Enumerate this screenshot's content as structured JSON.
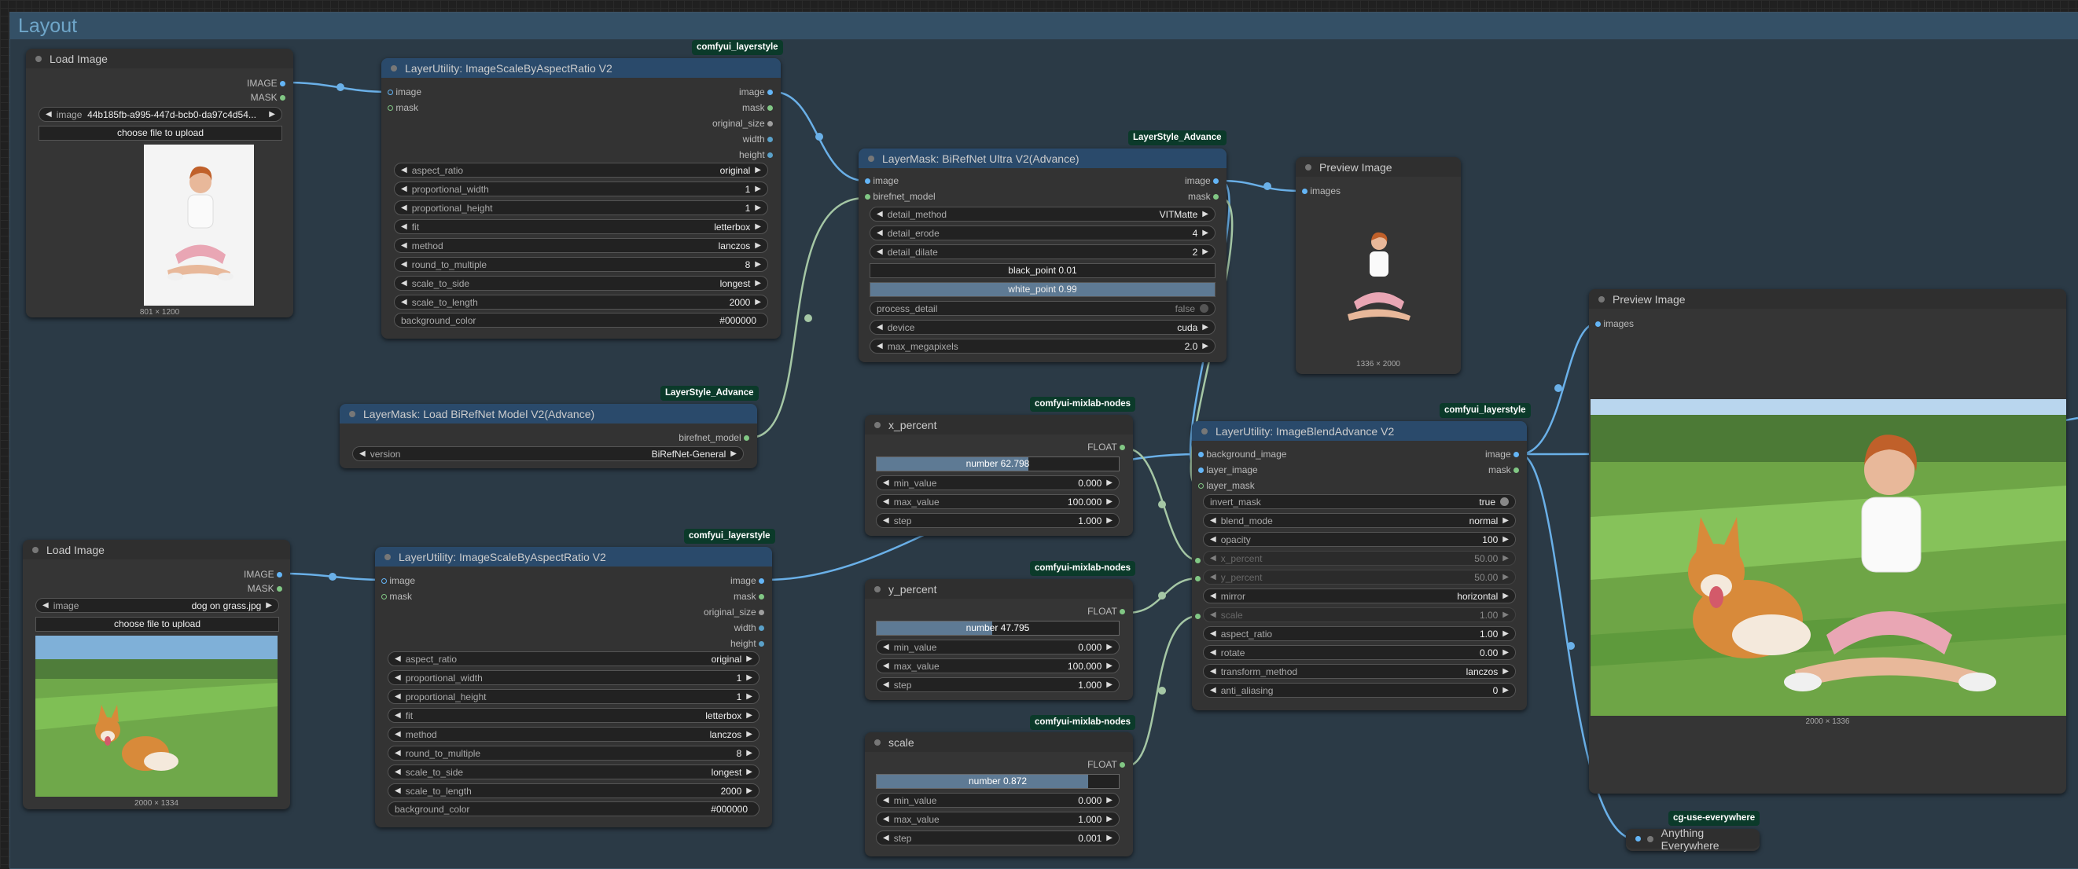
{
  "group": {
    "title": "Layout"
  },
  "load1": {
    "title": "Load Image",
    "out_image": "IMAGE",
    "out_mask": "MASK",
    "image_label": "image",
    "image_value": "44b185fb-a995-447d-bcb0-da97c4d54...",
    "upload": "choose file to upload",
    "dims": "801 × 1200"
  },
  "load2": {
    "title": "Load Image",
    "out_image": "IMAGE",
    "out_mask": "MASK",
    "image_label": "image",
    "image_value": "dog on grass.jpg",
    "upload": "choose file to upload",
    "dims": "2000 × 1334"
  },
  "scale1": {
    "badge": "comfyui_layerstyle",
    "title": "LayerUtility: ImageScaleByAspectRatio V2",
    "inputs": [
      "image",
      "mask"
    ],
    "outputs": [
      "image",
      "mask",
      "original_size",
      "width",
      "height"
    ],
    "widgets": [
      {
        "l": "aspect_ratio",
        "v": "original"
      },
      {
        "l": "proportional_width",
        "v": "1"
      },
      {
        "l": "proportional_height",
        "v": "1"
      },
      {
        "l": "fit",
        "v": "letterbox"
      },
      {
        "l": "method",
        "v": "lanczos"
      },
      {
        "l": "round_to_multiple",
        "v": "8"
      },
      {
        "l": "scale_to_side",
        "v": "longest"
      },
      {
        "l": "scale_to_length",
        "v": "2000"
      }
    ],
    "bg_label": "background_color",
    "bg_value": "#000000"
  },
  "scale2": {
    "badge": "comfyui_layerstyle",
    "title": "LayerUtility: ImageScaleByAspectRatio V2",
    "inputs": [
      "image",
      "mask"
    ],
    "outputs": [
      "image",
      "mask",
      "original_size",
      "width",
      "height"
    ],
    "widgets": [
      {
        "l": "aspect_ratio",
        "v": "original"
      },
      {
        "l": "proportional_width",
        "v": "1"
      },
      {
        "l": "proportional_height",
        "v": "1"
      },
      {
        "l": "fit",
        "v": "letterbox"
      },
      {
        "l": "method",
        "v": "lanczos"
      },
      {
        "l": "round_to_multiple",
        "v": "8"
      },
      {
        "l": "scale_to_side",
        "v": "longest"
      },
      {
        "l": "scale_to_length",
        "v": "2000"
      }
    ],
    "bg_label": "background_color",
    "bg_value": "#000000"
  },
  "loadmodel": {
    "badge": "LayerStyle_Advance",
    "title": "LayerMask: Load BiRefNet Model V2(Advance)",
    "output": "birefnet_model",
    "version_label": "version",
    "version_value": "BiRefNet-General"
  },
  "birefnet": {
    "badge": "LayerStyle_Advance",
    "title": "LayerMask: BiRefNet Ultra V2(Advance)",
    "inputs": [
      "image",
      "birefnet_model"
    ],
    "outputs": [
      "image",
      "mask"
    ],
    "w1": [
      {
        "l": "detail_method",
        "v": "VITMatte"
      },
      {
        "l": "detail_erode",
        "v": "4"
      },
      {
        "l": "detail_dilate",
        "v": "2"
      }
    ],
    "black_point": "black_point  0.01",
    "white_point": "white_point  0.99",
    "process_label": "process_detail",
    "process_value": "false",
    "w2": [
      {
        "l": "device",
        "v": "cuda"
      },
      {
        "l": "max_megapixels",
        "v": "2.0"
      }
    ]
  },
  "preview1": {
    "title": "Preview Image",
    "input": "images",
    "dims": "1336 × 2000"
  },
  "preview2": {
    "title": "Preview Image",
    "input": "images",
    "dims": "2000 × 1336"
  },
  "xpercent": {
    "badge": "comfyui-mixlab-nodes",
    "title": "x_percent",
    "out": "FLOAT",
    "number": "number  62.798",
    "fill": 0.628,
    "widgets": [
      {
        "l": "min_value",
        "v": "0.000"
      },
      {
        "l": "max_value",
        "v": "100.000"
      },
      {
        "l": "step",
        "v": "1.000"
      }
    ]
  },
  "ypercent": {
    "badge": "comfyui-mixlab-nodes",
    "title": "y_percent",
    "out": "FLOAT",
    "number": "number  47.795",
    "fill": 0.478,
    "widgets": [
      {
        "l": "min_value",
        "v": "0.000"
      },
      {
        "l": "max_value",
        "v": "100.000"
      },
      {
        "l": "step",
        "v": "1.000"
      }
    ]
  },
  "scalenode": {
    "badge": "comfyui-mixlab-nodes",
    "title": "scale",
    "out": "FLOAT",
    "number": "number  0.872",
    "fill": 0.872,
    "widgets": [
      {
        "l": "min_value",
        "v": "0.000"
      },
      {
        "l": "max_value",
        "v": "1.000"
      },
      {
        "l": "step",
        "v": "0.001"
      }
    ]
  },
  "blend": {
    "badge": "comfyui_layerstyle",
    "title": "LayerUtility: ImageBlendAdvance V2",
    "inputs": [
      "background_image",
      "layer_image",
      "layer_mask"
    ],
    "outputs": [
      "image",
      "mask"
    ],
    "invert_label": "invert_mask",
    "invert_value": "true",
    "widgets": [
      {
        "l": "blend_mode",
        "v": "normal",
        "d": false
      },
      {
        "l": "opacity",
        "v": "100",
        "d": false
      },
      {
        "l": "x_percent",
        "v": "50.00",
        "d": true
      },
      {
        "l": "y_percent",
        "v": "50.00",
        "d": true
      },
      {
        "l": "mirror",
        "v": "horizontal",
        "d": false
      },
      {
        "l": "scale",
        "v": "1.00",
        "d": true
      },
      {
        "l": "aspect_ratio",
        "v": "1.00",
        "d": false
      },
      {
        "l": "rotate",
        "v": "0.00",
        "d": false
      },
      {
        "l": "transform_method",
        "v": "lanczos",
        "d": false
      },
      {
        "l": "anti_aliasing",
        "v": "0",
        "d": false
      }
    ]
  },
  "anything": {
    "badge": "cg-use-everywhere",
    "title": "Anything Everywhere"
  },
  "colors": {
    "image_pin": "#64b5f6",
    "mask_pin": "#81c784",
    "wire": "#6ab0e8",
    "wire_mask": "#a5c7a5",
    "badge_bg": "#0b3a2a"
  }
}
